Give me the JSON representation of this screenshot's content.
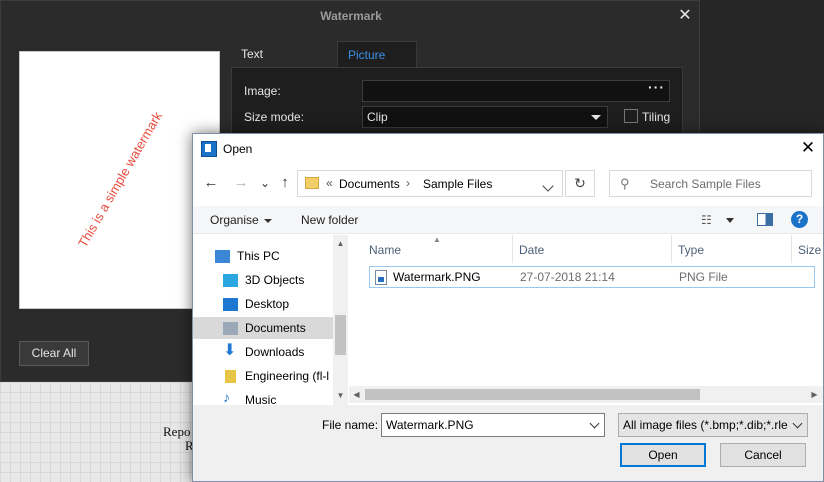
{
  "background": {
    "report_line1": "Repo",
    "report_line2": "R"
  },
  "watermark_dialog": {
    "title": "Watermark",
    "close_glyph": "✕",
    "preview_text": "This is a simple watermark",
    "clear_all_label": "Clear All",
    "tabs": [
      "Text Watermark",
      "Picture Watermark"
    ],
    "active_tab": "Picture Watermark",
    "image_label": "Image:",
    "image_value": "",
    "browse_glyph": "···",
    "size_mode_label": "Size mode:",
    "size_mode_value": "Clip",
    "tiling_label": "Tiling"
  },
  "open_dialog": {
    "title": "Open",
    "close_glyph": "✕",
    "nav": {
      "back": "←",
      "forward": "→",
      "recent": "⌄",
      "up": "↑"
    },
    "address": {
      "overflow": "«",
      "segments": [
        "Documents",
        "Sample Files"
      ],
      "separator": "›"
    },
    "refresh_glyph": "↻",
    "search_placeholder": "Search Sample Files",
    "search_glyph": "⚲",
    "toolbar": {
      "organise_label": "Organise",
      "new_folder_label": "New folder",
      "view_glyph": "☷",
      "help_glyph": "?"
    },
    "tree": [
      {
        "label": "This PC",
        "icon": "pc-icon",
        "color": "#3a87d8",
        "selected": false
      },
      {
        "label": "3D Objects",
        "icon": "cube-icon",
        "color": "#2aa7e0",
        "selected": false
      },
      {
        "label": "Desktop",
        "icon": "desktop-icon",
        "color": "#1e78d2",
        "selected": false
      },
      {
        "label": "Documents",
        "icon": "documents-icon",
        "color": "#9aa8b8",
        "selected": true
      },
      {
        "label": "Downloads",
        "icon": "download-arrow-icon",
        "color": "#1e78d2",
        "selected": false
      },
      {
        "label": "Engineering (fl-l",
        "icon": "network-drive-icon",
        "color": "#e8c547",
        "selected": false
      },
      {
        "label": "Music",
        "icon": "music-icon",
        "color": "#1e78d2",
        "selected": false
      }
    ],
    "columns": [
      "Name",
      "Date",
      "Type",
      "Size"
    ],
    "files": [
      {
        "name": "Watermark.PNG",
        "date": "27-07-2018 21:14",
        "type": "PNG File"
      }
    ],
    "file_name_label": "File name:",
    "file_name_value": "Watermark.PNG",
    "file_type_value": "All image files (*.bmp;*.dib;*.rle",
    "open_label": "Open",
    "cancel_label": "Cancel"
  }
}
